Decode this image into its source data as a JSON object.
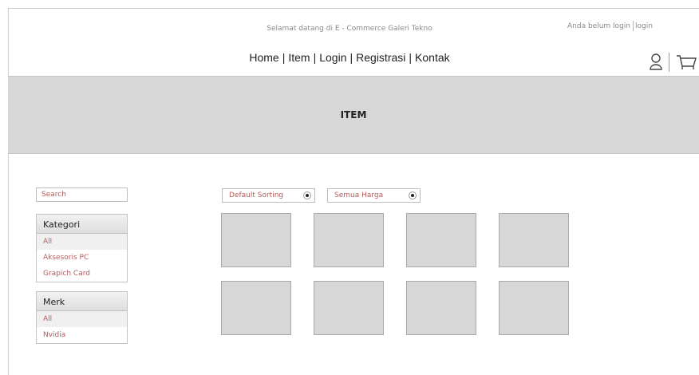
{
  "header": {
    "welcome": "Selamat datang di E - Commerce Galeri Tekno",
    "login_status": "Anda belum login",
    "login_link": "login",
    "nav": [
      {
        "label": "Home",
        "bold": false
      },
      {
        "label": "Item",
        "bold": false
      },
      {
        "label": "Login",
        "bold": true
      },
      {
        "label": "Registrasi",
        "bold": true
      },
      {
        "label": "Kontak",
        "bold": false
      }
    ],
    "icons": [
      "user-icon",
      "cart-icon"
    ]
  },
  "banner": {
    "title": "ITEM"
  },
  "sidebar": {
    "search_placeholder": "Search",
    "kategori": {
      "title": "Kategori",
      "items": [
        "All",
        "Aksesoris PC",
        "Grapich Card"
      ]
    },
    "merk": {
      "title": "Merk",
      "items": [
        "All",
        "Nvidia"
      ]
    }
  },
  "toolbar": {
    "sorting": "Default Sorting",
    "price": "Semua Harga"
  },
  "products": {
    "rows": 2,
    "columns": 4
  }
}
